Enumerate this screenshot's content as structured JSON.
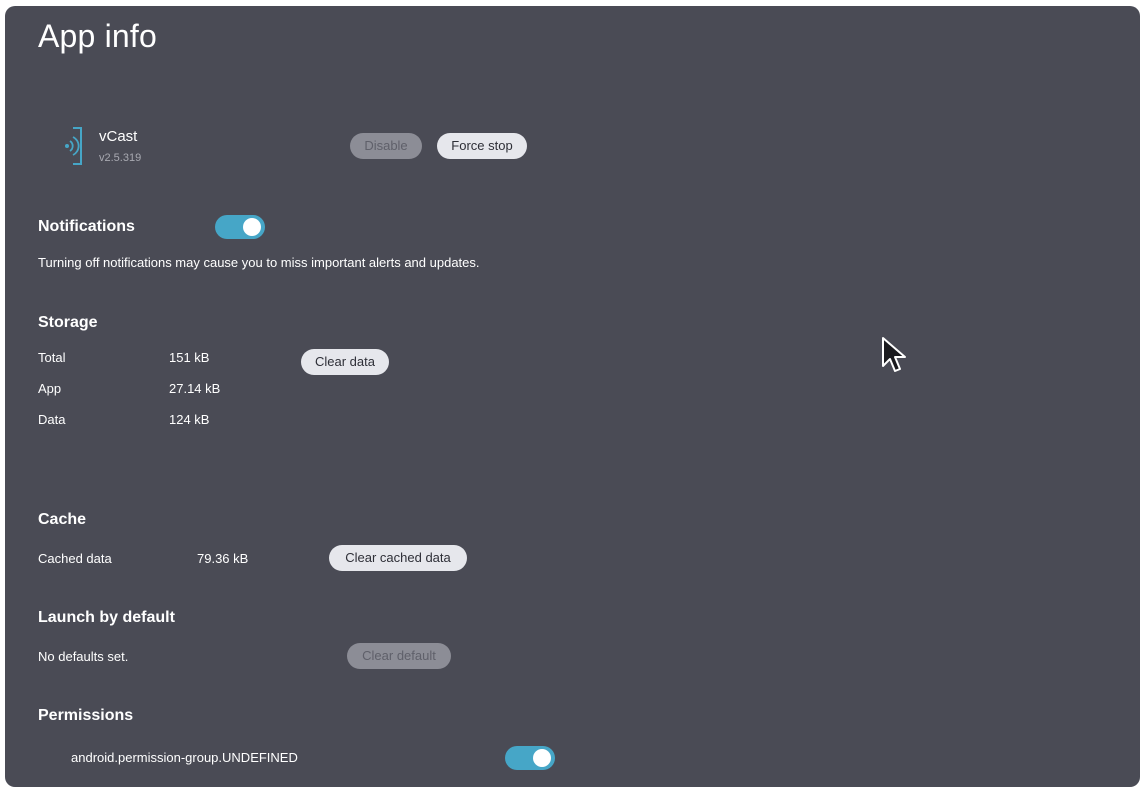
{
  "header": {
    "title": "App info"
  },
  "app": {
    "name": "vCast",
    "version": "v2.5.319",
    "disable_label": "Disable",
    "force_stop_label": "Force stop",
    "icon": "cast-receiver-icon"
  },
  "notifications": {
    "title": "Notifications",
    "enabled": true,
    "description": "Turning off notifications may cause you to miss important alerts and updates."
  },
  "storage": {
    "title": "Storage",
    "rows": [
      {
        "label": "Total",
        "value": "151 kB"
      },
      {
        "label": "App",
        "value": "27.14 kB"
      },
      {
        "label": "Data",
        "value": "124 kB"
      }
    ],
    "clear_data_label": "Clear data"
  },
  "cache": {
    "title": "Cache",
    "label": "Cached data",
    "value": "79.36 kB",
    "clear_cache_label": "Clear cached data"
  },
  "launch_default": {
    "title": "Launch by default",
    "status": "No defaults set.",
    "clear_default_label": "Clear default"
  },
  "permissions": {
    "title": "Permissions",
    "items": [
      {
        "name": "android.permission-group.UNDEFINED",
        "enabled": true
      }
    ]
  },
  "colors": {
    "panel_bg": "#4a4b55",
    "toggle_on": "#46a6c7",
    "button_bg": "#e6e7ec",
    "button_disabled_bg": "#8c8d96"
  }
}
